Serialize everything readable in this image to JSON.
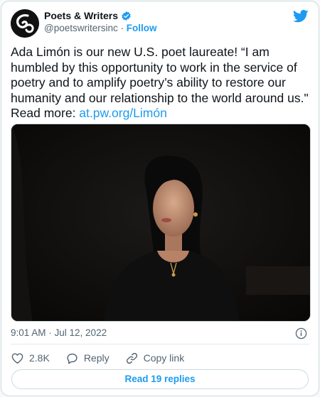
{
  "author": {
    "name": "Poets & Writers",
    "handle": "@poetswritersinc",
    "separator": "·",
    "follow_label": "Follow",
    "verified": true
  },
  "icons": {
    "verified": "verified-badge-icon",
    "brand": "twitter-bird-icon",
    "info": "info-icon",
    "like": "heart-icon",
    "reply": "reply-bubble-icon",
    "copy": "link-icon"
  },
  "tweet": {
    "text": "Ada Limón is our new U.S. poet laureate! “I am humbled by this opportunity to work in the service of poetry and to amplify poetry’s ability to restore our humanity and our relationship to the world around us.\" Read more: ",
    "link_text": "at.pw.org/Limón"
  },
  "timestamp": "9:01 AM · Jul 12, 2022",
  "actions": {
    "like_count": "2.8K",
    "reply_label": "Reply",
    "copy_label": "Copy link"
  },
  "replies_button": "Read 19 replies",
  "colors": {
    "accent": "#1d9bf0",
    "text": "#0f1419",
    "muted": "#536471",
    "border": "#cfd9de"
  }
}
